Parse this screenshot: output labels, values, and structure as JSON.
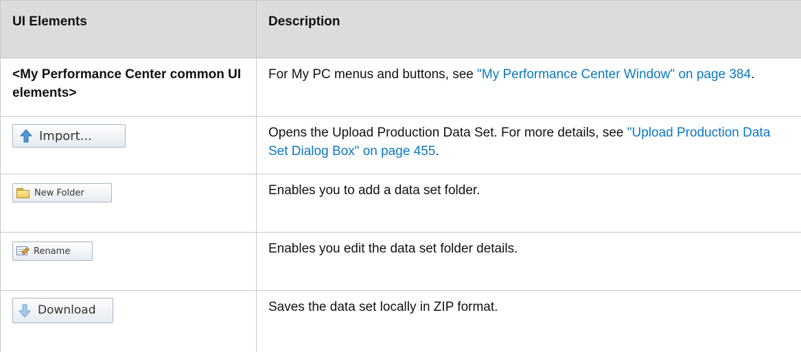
{
  "table": {
    "headers": {
      "ui_elements": "UI Elements",
      "description": "Description"
    },
    "rows": [
      {
        "element_text": "<My Performance Center common UI elements>",
        "description_prefix": "For My PC menus and buttons, see ",
        "link_text": "\"My Performance Center Window\" on page 384",
        "description_suffix": "."
      },
      {
        "button_label": "Import...",
        "description_prefix": "Opens the Upload Production Data Set. For more details, see ",
        "link_text": "\"Upload Production Data Set Dialog Box\" on page 455",
        "description_suffix": "."
      },
      {
        "button_label": "New Folder",
        "description": "Enables you to add a data set folder."
      },
      {
        "button_label": "Rename",
        "description": "Enables you edit the data set folder details."
      },
      {
        "button_label": "Download",
        "description": "Saves the data set locally in ZIP format."
      }
    ]
  },
  "colors": {
    "header_background": "#dcdcdc",
    "border": "#c8c8c8",
    "link": "#0b78c2",
    "button_border": "#a9b4c0"
  },
  "icons": {
    "import": "up-arrow-icon",
    "new_folder": "folder-icon",
    "rename": "rename-icon",
    "download": "down-arrow-icon"
  }
}
